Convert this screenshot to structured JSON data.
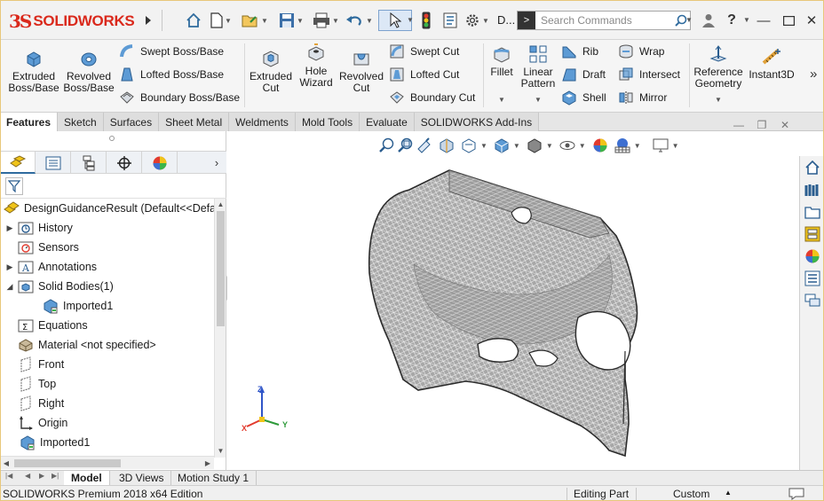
{
  "app": {
    "brand": "SOLIDWORKS",
    "brand_mark": "3S",
    "doc_short": "D...",
    "search_placeholder": "Search Commands",
    "colors": {
      "brand_red": "#da291c",
      "icon_blue": "#2f6b9e",
      "selection_bg": "#dce8f6"
    }
  },
  "quick_access": [
    {
      "name": "home-icon"
    },
    {
      "name": "new-document-icon"
    },
    {
      "name": "open-folder-icon"
    },
    {
      "name": "save-icon"
    },
    {
      "name": "print-icon"
    },
    {
      "name": "undo-icon"
    },
    {
      "name": "select-arrow-icon"
    },
    {
      "name": "rebuild-icon"
    },
    {
      "name": "file-properties-icon"
    },
    {
      "name": "options-gear-icon"
    }
  ],
  "ribbon": {
    "extruded_boss": "Extruded Boss/Base",
    "revolved_boss": "Revolved Boss/Base",
    "swept_boss": "Swept Boss/Base",
    "lofted_boss": "Lofted Boss/Base",
    "boundary_boss": "Boundary Boss/Base",
    "extruded_cut": "Extruded Cut",
    "hole_wizard": "Hole Wizard",
    "revolved_cut": "Revolved Cut",
    "swept_cut": "Swept Cut",
    "lofted_cut": "Lofted Cut",
    "boundary_cut": "Boundary Cut",
    "fillet": "Fillet",
    "linear_pattern": "Linear Pattern",
    "rib": "Rib",
    "draft": "Draft",
    "shell": "Shell",
    "wrap": "Wrap",
    "intersect": "Intersect",
    "mirror": "Mirror",
    "reference_geometry": "Reference Geometry",
    "instant3d": "Instant3D"
  },
  "tabs": [
    "Features",
    "Sketch",
    "Surfaces",
    "Sheet Metal",
    "Weldments",
    "Mold Tools",
    "Evaluate",
    "SOLIDWORKS Add-Ins"
  ],
  "feature_tree": {
    "root": "DesignGuidanceResult  (Default<<Default",
    "items": [
      {
        "label": "History",
        "icon": "history-folder-icon",
        "expandable": true
      },
      {
        "label": "Sensors",
        "icon": "sensors-icon",
        "expandable": false
      },
      {
        "label": "Annotations",
        "icon": "annotations-icon",
        "expandable": true
      },
      {
        "label": "Solid Bodies(1)",
        "icon": "solid-bodies-folder-icon",
        "expandable": true,
        "expanded": true
      },
      {
        "label": "Imported1",
        "icon": "imported-body-icon",
        "indent": true
      },
      {
        "label": "Equations",
        "icon": "equations-icon",
        "expandable": false
      },
      {
        "label": "Material <not specified>",
        "icon": "material-icon",
        "expandable": false
      },
      {
        "label": "Front",
        "icon": "plane-icon"
      },
      {
        "label": "Top",
        "icon": "plane-icon"
      },
      {
        "label": "Right",
        "icon": "plane-icon"
      },
      {
        "label": "Origin",
        "icon": "origin-icon"
      },
      {
        "label": "Imported1",
        "icon": "imported-feature-icon"
      }
    ]
  },
  "triad": {
    "x": "X",
    "y": "Y",
    "z": "Z"
  },
  "bottom_tabs": [
    "Model",
    "3D Views",
    "Motion Study 1"
  ],
  "status": {
    "edition": "SOLIDWORKS Premium 2018 x64 Edition",
    "mode": "Editing Part",
    "units": "Custom",
    "units_caret": "▲"
  }
}
